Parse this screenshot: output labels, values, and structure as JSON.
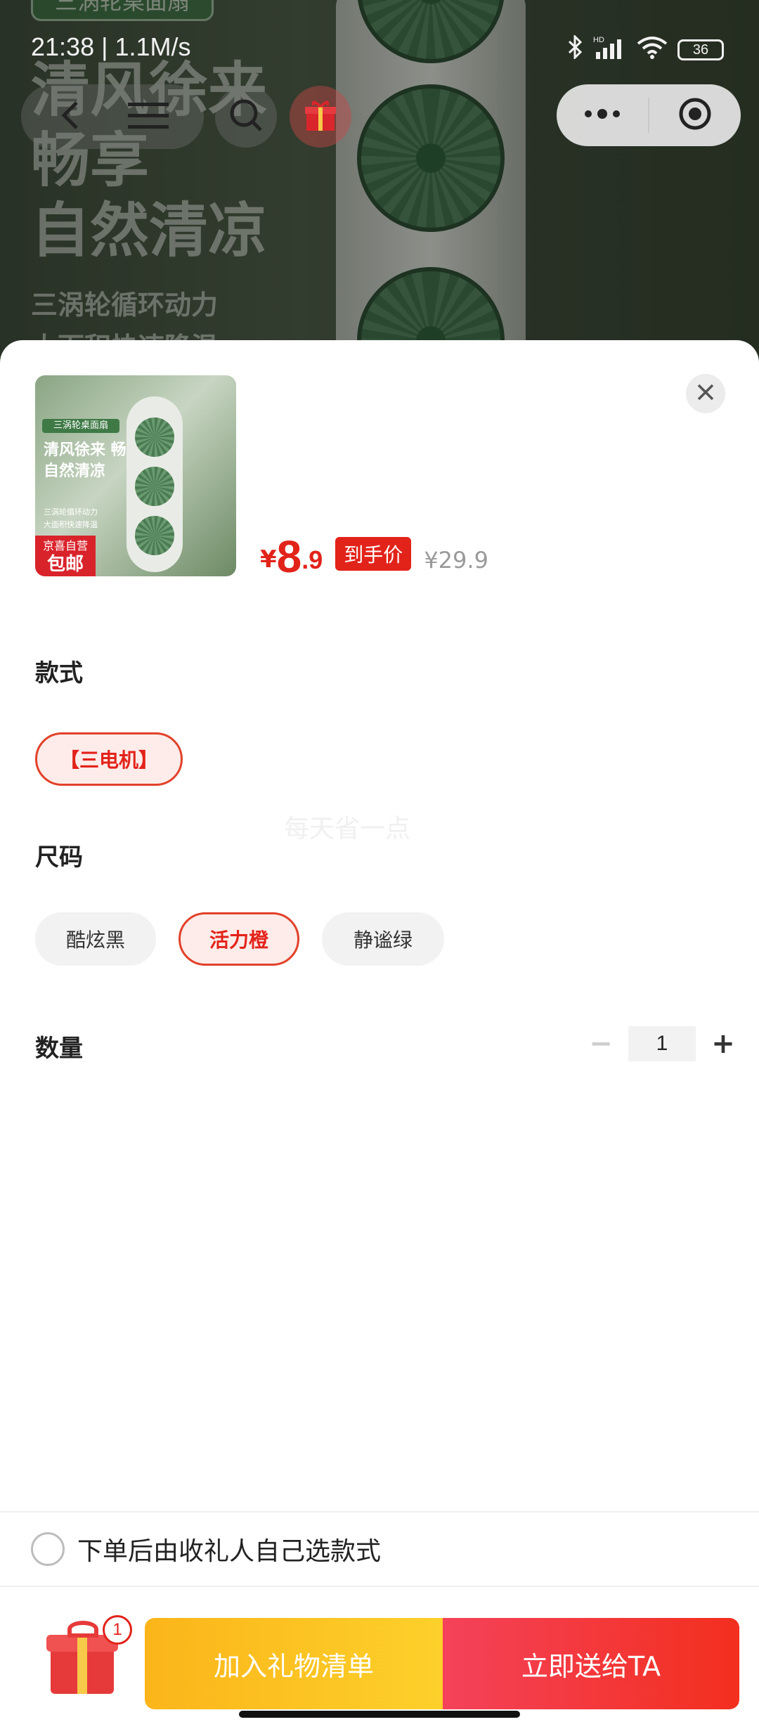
{
  "status_bar": {
    "time": "21:38 | 1.1M/s",
    "battery": "36",
    "network": "HD"
  },
  "hero": {
    "tag": "三涡轮桌面扇",
    "headline": [
      "清风徐来",
      "畅享",
      "自然清凉"
    ],
    "subline": [
      "三涡轮循环动力",
      "大面积快速降温"
    ]
  },
  "product": {
    "thumb_tag": "三涡轮桌面扇",
    "thumb_headline": "清风徐来 畅享 自然清凉",
    "thumb_sub_1": "三涡轮循环动力",
    "thumb_sub_2": "大面积快速降温",
    "thumb_badge_top": "京喜自营",
    "thumb_badge_bottom": "包邮",
    "price_currency": "¥",
    "price_integer": "8",
    "price_decimal": ".9",
    "price_label": "到手价",
    "original_price": "¥29.9"
  },
  "style_section": {
    "title": "款式",
    "options": [
      {
        "label": "【三电机】",
        "selected": true
      }
    ]
  },
  "size_section": {
    "title": "尺码",
    "options": [
      {
        "label": "酷炫黑",
        "selected": false
      },
      {
        "label": "活力橙",
        "selected": true
      },
      {
        "label": "静谧绿",
        "selected": false
      }
    ]
  },
  "watermark": "每天省一点",
  "quantity": {
    "label": "数量",
    "value": "1",
    "minus": "−",
    "plus": "+"
  },
  "self_select": {
    "label": "下单后由收礼人自己选款式",
    "checked": false
  },
  "bottom_bar": {
    "gift_count": "1",
    "add_button": "加入礼物清单",
    "send_button": "立即送给TA",
    "colors": {
      "add": "#fdc020",
      "send": "#f33a2e",
      "price": "#e2231a"
    }
  }
}
